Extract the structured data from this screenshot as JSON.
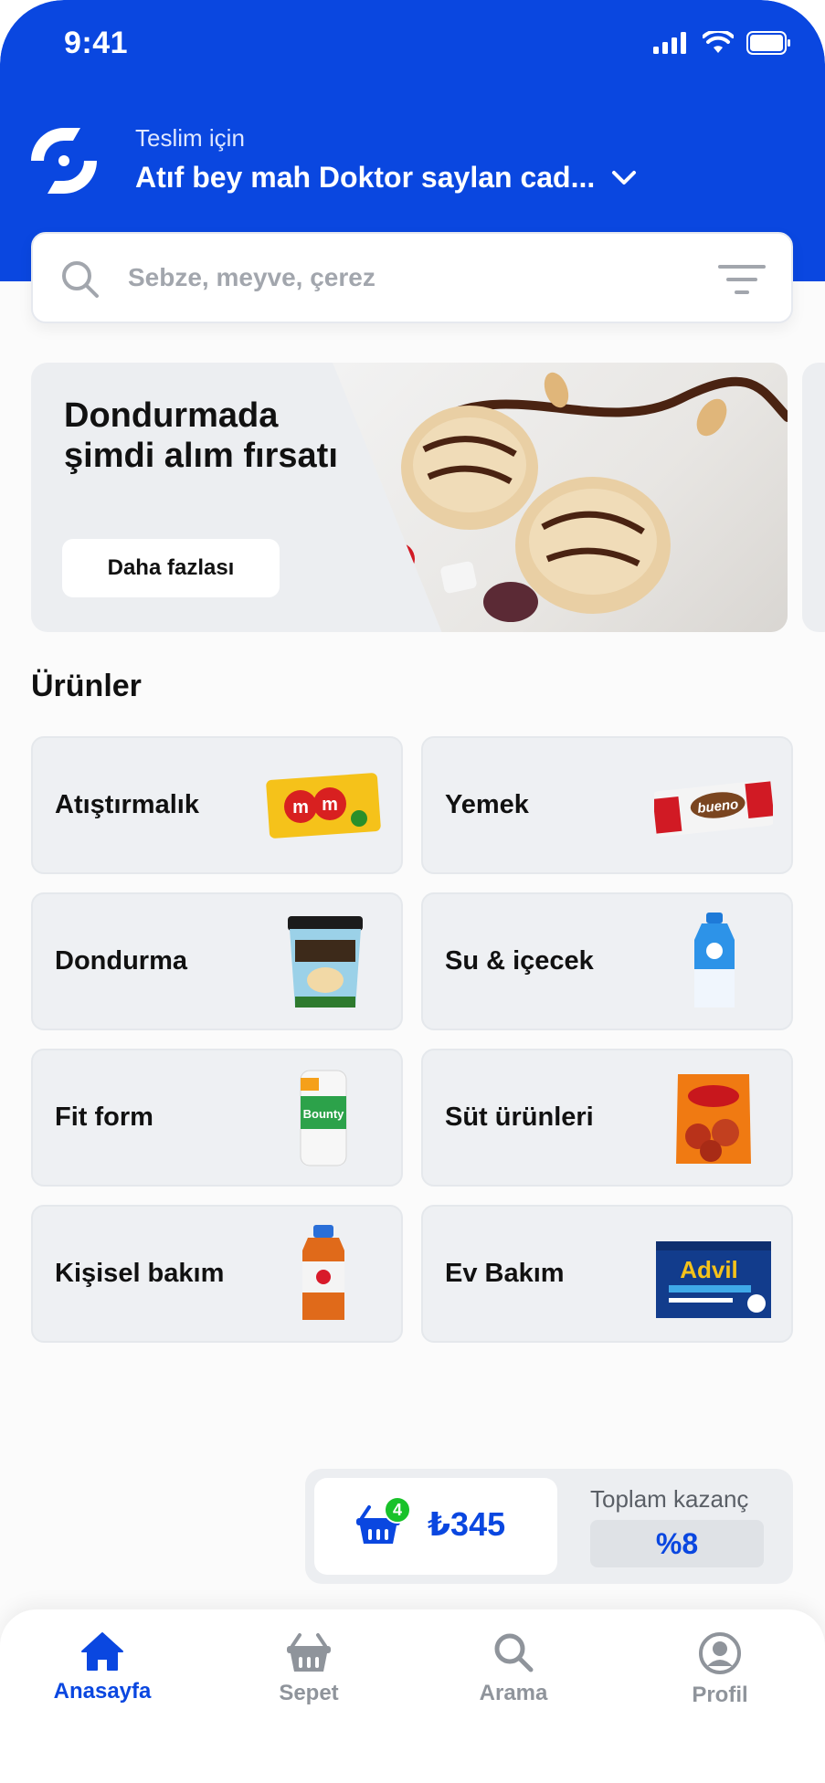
{
  "status_bar": {
    "time": "9:41"
  },
  "header": {
    "deliver_label": "Teslim için",
    "address": "Atıf bey mah Doktor saylan cad..."
  },
  "search": {
    "placeholder": "Sebze, meyve, çerez"
  },
  "banner": {
    "title": "Dondurmada şimdi alım fırsatı",
    "button_label": "Daha fazlası"
  },
  "products": {
    "section_title": "Ürünler",
    "categories": [
      {
        "label": "Atıştırmalık",
        "image": "mms-candy-pack"
      },
      {
        "label": "Yemek",
        "image": "kinder-bueno-bar"
      },
      {
        "label": "Dondurma",
        "image": "ben-jerrys-tub"
      },
      {
        "label": "Su & içecek",
        "image": "fairlife-milk-bottle"
      },
      {
        "label": "Fit form",
        "image": "bounty-paper-towel"
      },
      {
        "label": "Süt ürünleri",
        "image": "tyson-any-tizers-bag"
      },
      {
        "label": "Kişisel bakım",
        "image": "pedialyte-bottle"
      },
      {
        "label": "Ev Bakım",
        "image": "advil-liqui-gels-box"
      }
    ]
  },
  "cart": {
    "badge_count": "4",
    "total": "₺345",
    "earn_label": "Toplam kazanç",
    "earn_value": "%8"
  },
  "tabbar": {
    "tabs": [
      {
        "label": "Anasayfa",
        "icon": "home-icon",
        "active": true
      },
      {
        "label": "Sepet",
        "icon": "basket-icon",
        "active": false
      },
      {
        "label": "Arama",
        "icon": "search-icon",
        "active": false
      },
      {
        "label": "Profil",
        "icon": "profile-icon",
        "active": false
      }
    ]
  },
  "colors": {
    "brand_blue": "#0a47e0",
    "badge_green": "#19c22a",
    "card_bg": "#eef0f3"
  }
}
